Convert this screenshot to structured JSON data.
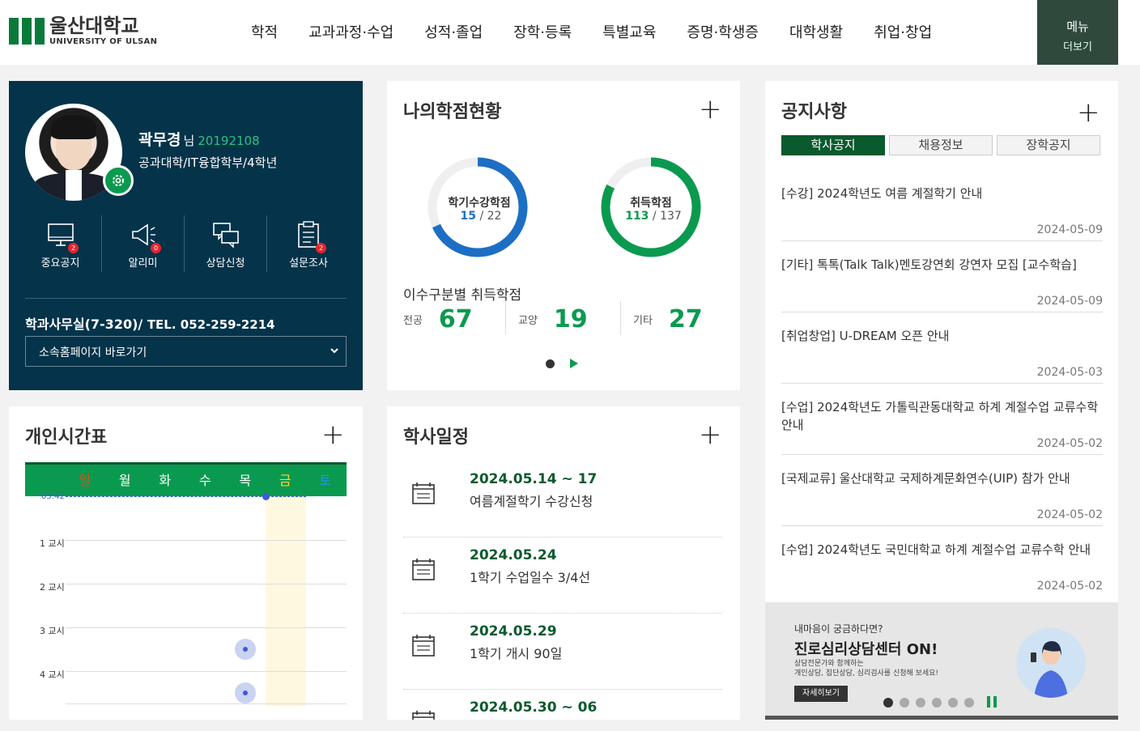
{
  "header": {
    "logo_ko": "울산대학교",
    "logo_en": "UNIVERSITY OF ULSAN",
    "nav": [
      "학적",
      "교과과정·수업",
      "성적·졸업",
      "장학·등록",
      "특별교육",
      "증명·학생증",
      "대학생활",
      "취업·창업"
    ],
    "menu_more_1": "메뉴",
    "menu_more_2": "더보기"
  },
  "profile": {
    "name": "곽무경",
    "honorific": "님",
    "student_id": "20192108",
    "department": "공과대학/IT융합학부/4학년",
    "quick_links": [
      {
        "label": "중요공지",
        "badge": "2",
        "icon": "monitor-icon"
      },
      {
        "label": "알리미",
        "badge": "0",
        "icon": "megaphone-icon"
      },
      {
        "label": "상담신청",
        "badge": "",
        "icon": "chat-icon"
      },
      {
        "label": "설문조사",
        "badge": "2",
        "icon": "clipboard-icon"
      }
    ],
    "office_prefix": "학과사무실(7-320)/ ",
    "office_tel": "TEL. 052-259-2214",
    "homepage_select": "소속홈페이지 바로가기"
  },
  "credits": {
    "title": "나의학점현황",
    "semester": {
      "label": "학기수강학점",
      "value": 15,
      "total": 22
    },
    "acquired": {
      "label": "취득학점",
      "value": 113,
      "total": 137
    },
    "earned_title": "이수구분별 취득학점",
    "earned": [
      {
        "label": "전공",
        "value": "67"
      },
      {
        "label": "교양",
        "value": "19"
      },
      {
        "label": "기타",
        "value": "27"
      }
    ]
  },
  "notice": {
    "title": "공지사항",
    "tabs": [
      "학사공지",
      "채용정보",
      "장학공지"
    ],
    "items": [
      {
        "title": "[수강] 2024학년도 여름 계절학기 안내",
        "date": "2024-05-09"
      },
      {
        "title": "[기타] 톡톡(Talk Talk)멘토강연회 강연자 모집 [교수학습]",
        "date": "2024-05-09"
      },
      {
        "title": "[취업창업] U-DREAM 오픈 안내",
        "date": "2024-05-03"
      },
      {
        "title": "[수업] 2024학년도 가톨릭관동대학교 하계 계절수업 교류수학 안내",
        "date": "2024-05-02"
      },
      {
        "title": "[국제교류] 울산대학교 국제하계문화연수(UIP) 참가 안내",
        "date": "2024-05-02"
      },
      {
        "title": "[수업] 2024학년도 국민대학교 하계 계절수업 교류수학 안내",
        "date": "2024-05-02"
      }
    ]
  },
  "banner": {
    "line1": "내마음이 궁금하다면?",
    "line2": "진로심리상담센터 ON!",
    "line3a": "상담전문가와 함께하는",
    "line3b": "개인상담, 집단상담, 심리검사를 신청해 보세요!",
    "button": "자세히보기"
  },
  "timetable": {
    "title": "개인시간표",
    "days": [
      "일",
      "월",
      "화",
      "수",
      "목",
      "금",
      "토"
    ],
    "now_time": "05:42",
    "periods": [
      "1 교시",
      "2 교시",
      "3 교시",
      "4 교시"
    ]
  },
  "schedule": {
    "title": "학사일정",
    "items": [
      {
        "date": "2024.05.14 ~ 17",
        "text": "여름계절학기 수강신청"
      },
      {
        "date": "2024.05.24",
        "text": "1학기 수업일수 3/4선"
      },
      {
        "date": "2024.05.29",
        "text": "1학기 개시 90일"
      },
      {
        "date": "2024.05.30 ~ 06",
        "text": ""
      }
    ]
  },
  "colors": {
    "brand_green": "#0a9a4f",
    "dark_green": "#0a5a2e",
    "profile_bg": "#04334a",
    "donut_blue": "#1c6fc4",
    "badge_red": "#e3262e"
  }
}
